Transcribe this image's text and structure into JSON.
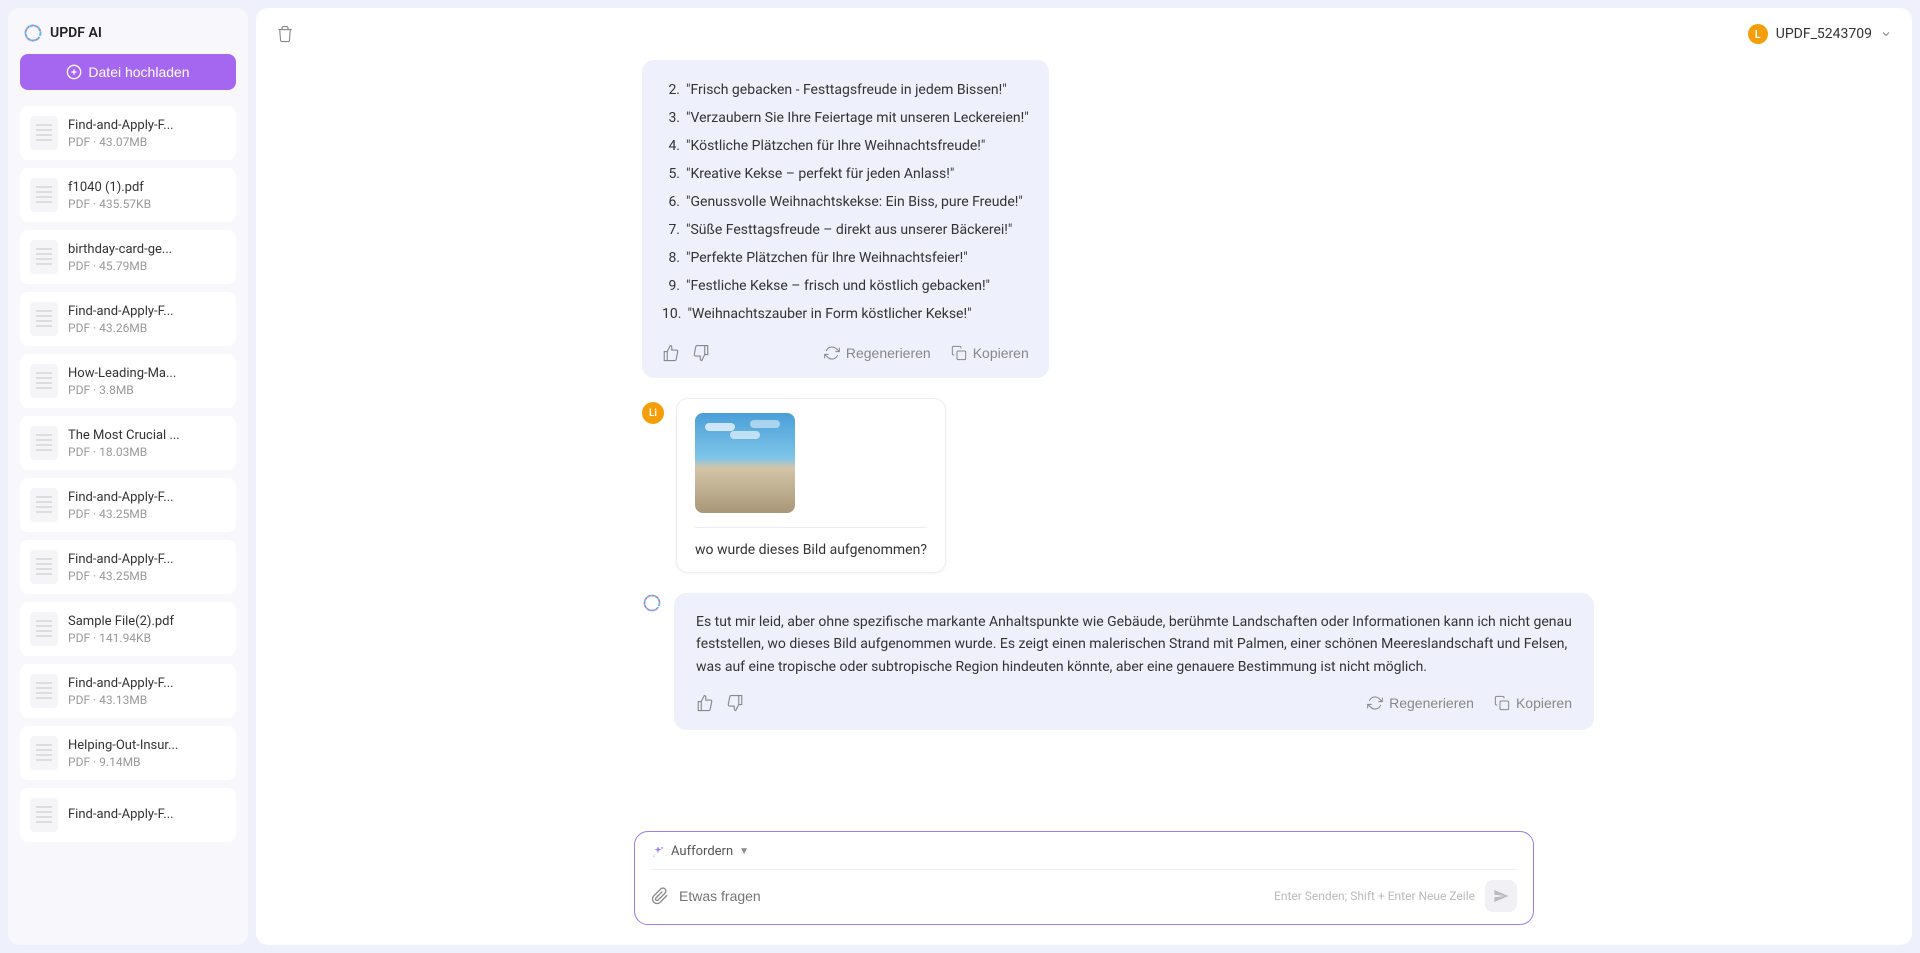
{
  "sidebar": {
    "title": "UPDF AI",
    "upload_label": "Datei hochladen",
    "files": [
      {
        "name": "Find-and-Apply-F...",
        "size": "PDF · 43.07MB"
      },
      {
        "name": "f1040 (1).pdf",
        "size": "PDF · 435.57KB"
      },
      {
        "name": "birthday-card-ge...",
        "size": "PDF · 45.79MB"
      },
      {
        "name": "Find-and-Apply-F...",
        "size": "PDF · 43.26MB"
      },
      {
        "name": "How-Leading-Ma...",
        "size": "PDF · 3.8MB"
      },
      {
        "name": "The Most Crucial ...",
        "size": "PDF · 18.03MB"
      },
      {
        "name": "Find-and-Apply-F...",
        "size": "PDF · 43.25MB"
      },
      {
        "name": "Find-and-Apply-F...",
        "size": "PDF · 43.25MB"
      },
      {
        "name": "Sample File(2).pdf",
        "size": "PDF · 141.94KB"
      },
      {
        "name": "Find-and-Apply-F...",
        "size": "PDF · 43.13MB"
      },
      {
        "name": "Helping-Out-Insur...",
        "size": "PDF · 9.14MB"
      },
      {
        "name": "Find-and-Apply-F...",
        "size": ""
      }
    ]
  },
  "header": {
    "username": "UPDF_5243709",
    "user_initial": "L"
  },
  "chat": {
    "bot1": {
      "items": [
        {
          "n": "2.",
          "t": "\"Frisch gebacken - Festtagsfreude in jedem Bissen!\""
        },
        {
          "n": "3.",
          "t": "\"Verzaubern Sie Ihre Feiertage mit unseren Leckereien!\""
        },
        {
          "n": "4.",
          "t": "\"Köstliche Plätzchen für Ihre Weihnachtsfreude!\""
        },
        {
          "n": "5.",
          "t": "\"Kreative Kekse – perfekt für jeden Anlass!\""
        },
        {
          "n": "6.",
          "t": "\"Genussvolle Weihnachtskekse: Ein Biss, pure Freude!\""
        },
        {
          "n": "7.",
          "t": "\"Süße Festtagsfreude – direkt aus unserer Bäckerei!\""
        },
        {
          "n": "8.",
          "t": "\"Perfekte Plätzchen für Ihre Weihnachtsfeier!\""
        },
        {
          "n": "9.",
          "t": "\"Festliche Kekse – frisch und köstlich gebacken!\""
        },
        {
          "n": "10.",
          "t": "\"Weihnachtszauber in Form köstlicher Kekse!\""
        }
      ],
      "regenerate": "Regenerieren",
      "copy": "Kopieren"
    },
    "user1": {
      "initial": "Li",
      "text": "wo wurde dieses Bild aufgenommen?"
    },
    "bot2": {
      "text": "Es tut mir leid, aber ohne spezifische markante Anhaltspunkte wie Gebäude, berühmte Landschaften oder Informationen kann ich nicht genau feststellen, wo dieses Bild aufgenommen wurde. Es zeigt einen malerischen Strand mit Palmen, einer schönen Meereslandschaft und Felsen, was auf eine tropische oder subtropische Region hindeuten könnte, aber eine genauere Bestimmung ist nicht möglich.",
      "regenerate": "Regenerieren",
      "copy": "Kopieren"
    }
  },
  "input": {
    "prompt_label": "Auffordern",
    "placeholder": "Etwas fragen",
    "hint": "Enter Senden; Shift + Enter Neue Zeile"
  }
}
